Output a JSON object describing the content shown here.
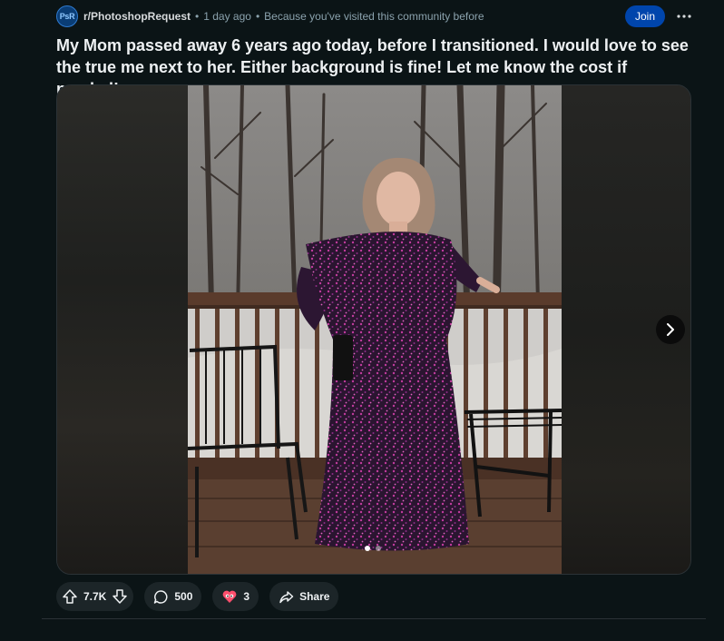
{
  "header": {
    "avatar_text": "PsR",
    "subreddit": "r/PhotoshopRequest",
    "separator": "•",
    "time": "1 day ago",
    "reason": "Because you've visited this community before",
    "join_label": "Join",
    "more_icon": "ellipsis-icon"
  },
  "post": {
    "title": "My Mom passed away 6 years ago today, before I transitioned. I would love to see the true me next to her. Either background is fine! Let me know the cost if needed!"
  },
  "media": {
    "total_images": 2,
    "current_index": 1,
    "next_icon": "chevron-right-icon"
  },
  "actions": {
    "votes": "7.7K",
    "comments": "500",
    "awards": "3",
    "share_label": "Share"
  },
  "colors": {
    "background": "#0b1416",
    "join_button": "#0045ac",
    "pill": "#1c2528",
    "text": "#d7dadc",
    "muted": "#8ba2ad"
  }
}
